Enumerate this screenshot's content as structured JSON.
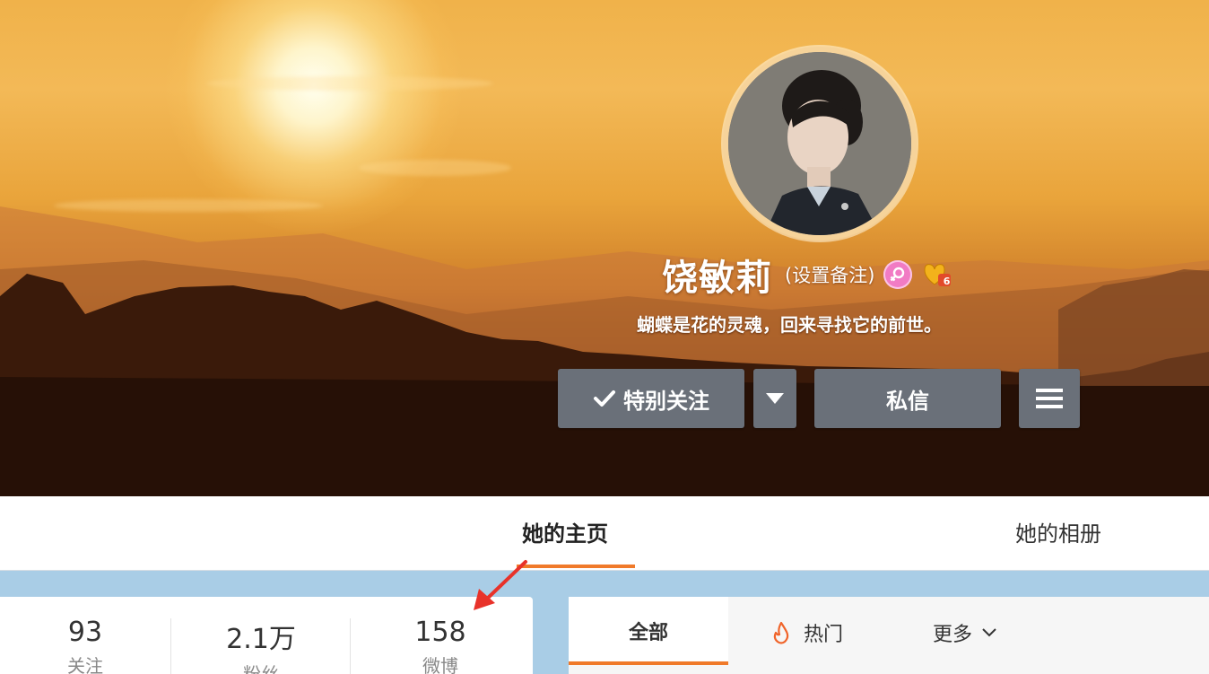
{
  "profile": {
    "name": "饶敏莉",
    "remark": "(设置备注)",
    "bio": "蝴蝶是花的灵魂，回来寻找它的前世。",
    "vip_level": "6"
  },
  "actions": {
    "follow_label": "特别关注",
    "message_label": "私信"
  },
  "tabs": {
    "home": "她的主页",
    "album": "她的相册"
  },
  "stats": [
    {
      "value": "93",
      "label": "关注"
    },
    {
      "value": "2.1万",
      "label": "粉丝"
    },
    {
      "value": "158",
      "label": "微博"
    }
  ],
  "feed_filter": {
    "all": "全部",
    "hot": "热门",
    "more": "更多"
  },
  "colors": {
    "accent": "#f07a2a",
    "button_bg": "#6a7079",
    "annotation_arrow": "#e8322a"
  }
}
